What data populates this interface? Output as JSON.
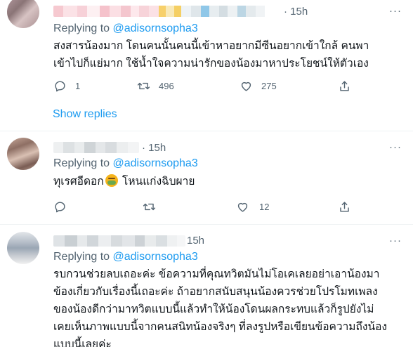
{
  "tweets": [
    {
      "time": "15h",
      "more_label": "···",
      "reply_prefix": "Replying to ",
      "reply_handle": "@adisornsopha3",
      "text_line1": "สงสารน้องมาก โดนคนนั้นคนนี้เข้าหาอยากมีซีนอยากเข้าใกล้ คนพา",
      "text_line2": "เข้าไปก็แย่มาก ใช้น้ำใจความน่ารักของน้องมาหาประโยชน์ให้ตัวเอง",
      "reply_count": "1",
      "retweet_count": "496",
      "like_count": "275",
      "show_replies": "Show replies"
    },
    {
      "time": "15h",
      "more_label": "···",
      "reply_prefix": "Replying to ",
      "reply_handle": "@adisornsopha3",
      "text_before_emoji": "ทุเรศอีดอก",
      "emoji_name": "nauseated-face-emoji",
      "text_after_emoji": " โหนแก่งฉิบผาย",
      "reply_count": "",
      "retweet_count": "",
      "like_count": "12"
    },
    {
      "time": "15h",
      "more_label": "···",
      "reply_prefix": "Replying to ",
      "reply_handle": "@adisornsopha3",
      "text_line1": "รบกวนช่วยลบเถอะค่ะ ข้อความที่คุณทวิตมันไม่โอเคเลยอย่าเอาน้องมา",
      "text_line2": "ข้องเกี่ยวกับเรื่องนี้เถอะค่ะ ถ้าอยากสนับสนุนน้องควรช่วยโปรโมทเพลง",
      "text_line3": "ของน้องดีกว่ามาทวิตแบบนี้แล้วทำให้น้องโดนผลกระทบแล้วก็รูปยังไม่",
      "text_line4": "เคยเห็นภาพแบบนี้จากคนสนิทน้องจริงๆ ที่ลงรูปหรือเขียนข้อความถึงน้อง",
      "text_line5": "แบบนี้เลยค่ะ"
    }
  ],
  "colors": {
    "link": "#1d9bf0",
    "secondary_text": "#536471",
    "primary_text": "#0f1419",
    "thread_line": "#cfd9de"
  },
  "icons": [
    "reply-icon",
    "retweet-icon",
    "like-icon",
    "share-icon",
    "more-icon"
  ]
}
